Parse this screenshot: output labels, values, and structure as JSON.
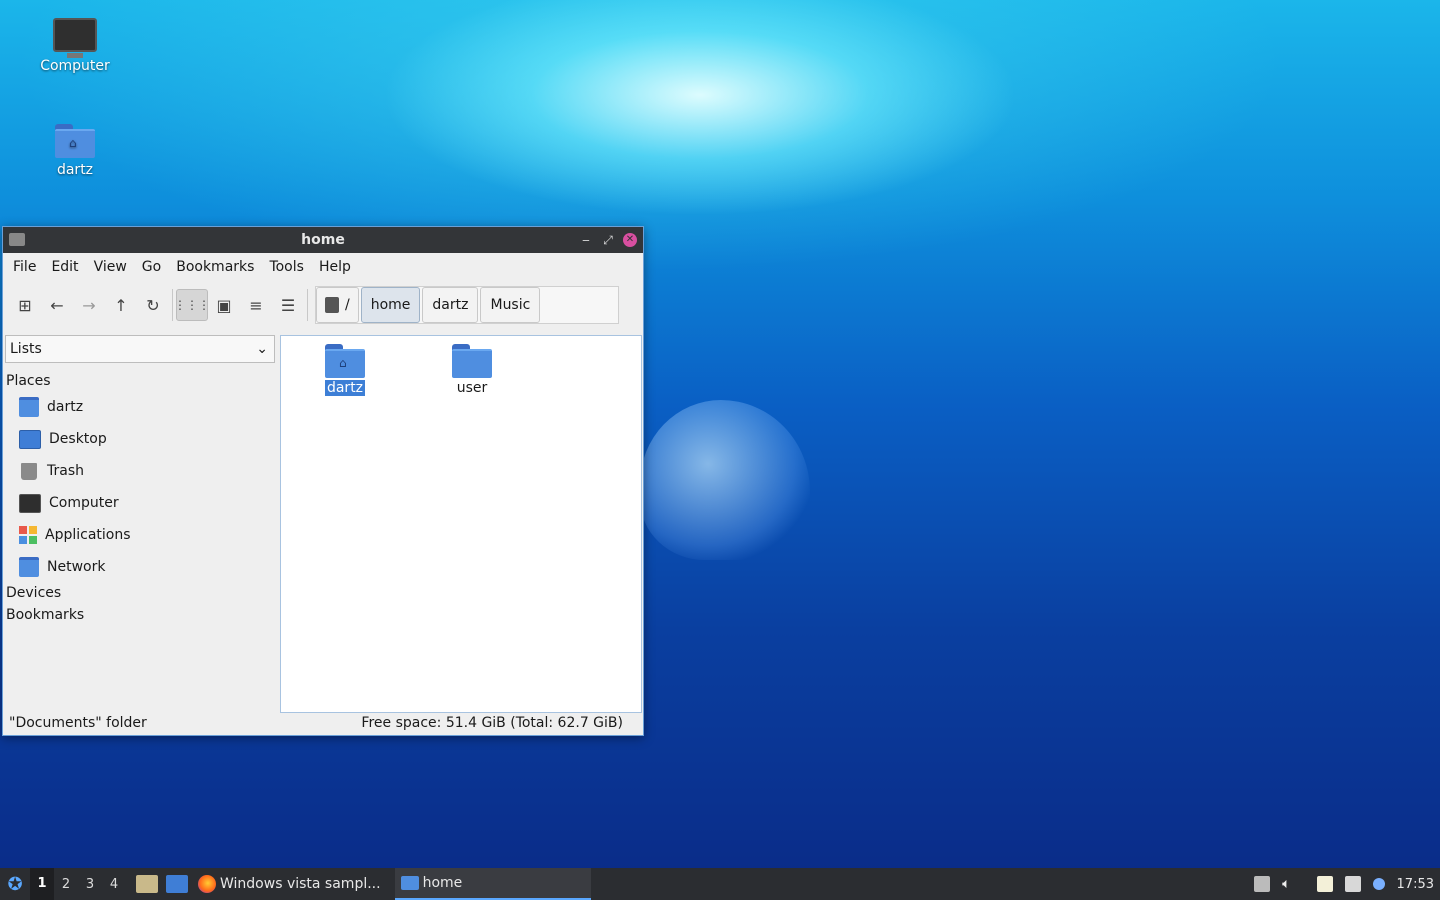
{
  "desktop": {
    "icons": [
      {
        "label": "Computer",
        "icon": "computer-icon"
      },
      {
        "label": "dartz",
        "icon": "home-folder-icon"
      }
    ]
  },
  "window": {
    "title": "home",
    "controls": {
      "minimize": "‒",
      "maximize": "⤢",
      "close": "✕"
    },
    "menu": [
      "File",
      "Edit",
      "View",
      "Go",
      "Bookmarks",
      "Tools",
      "Help"
    ],
    "toolbar": {
      "new_tab": "new-tab-icon",
      "back": "back-arrow-icon",
      "forward": "forward-arrow-icon",
      "up": "up-arrow-icon",
      "reload": "reload-icon",
      "icon_view": "icon-view-icon",
      "thumb_view": "thumbnail-view-icon",
      "compact_view": "compact-view-icon",
      "detail_view": "detailed-list-view-icon"
    },
    "path": {
      "root": "/",
      "crumbs": [
        "home",
        "dartz",
        "Music"
      ],
      "current": "home"
    },
    "sidebar": {
      "mode": "Lists",
      "places_header": "Places",
      "places": [
        {
          "label": "dartz",
          "icon": "home-folder-icon"
        },
        {
          "label": "Desktop",
          "icon": "desktop-icon"
        },
        {
          "label": "Trash",
          "icon": "trash-icon"
        },
        {
          "label": "Computer",
          "icon": "computer-icon"
        },
        {
          "label": "Applications",
          "icon": "applications-icon"
        },
        {
          "label": "Network",
          "icon": "network-icon"
        }
      ],
      "devices_header": "Devices",
      "bookmarks_header": "Bookmarks"
    },
    "files": [
      {
        "label": "dartz",
        "selected": true,
        "icon": "home-folder-icon"
      },
      {
        "label": "user",
        "selected": false,
        "icon": "folder-icon"
      }
    ],
    "status": {
      "left": "\"Documents\" folder",
      "right": "Free space: 51.4 GiB (Total: 62.7 GiB)"
    }
  },
  "taskbar": {
    "workspaces": [
      "1",
      "2",
      "3",
      "4"
    ],
    "current_workspace": "1",
    "tasks": [
      {
        "label": "Windows vista sampl...",
        "icon": "firefox-icon",
        "active": false
      },
      {
        "label": "home",
        "icon": "folder-icon",
        "active": true
      }
    ],
    "clock": "17:53"
  },
  "colors": {
    "accent": "#3d7fd6",
    "titlebar": "#333538",
    "close": "#d94fa0",
    "folder": "#4f8ee0"
  }
}
